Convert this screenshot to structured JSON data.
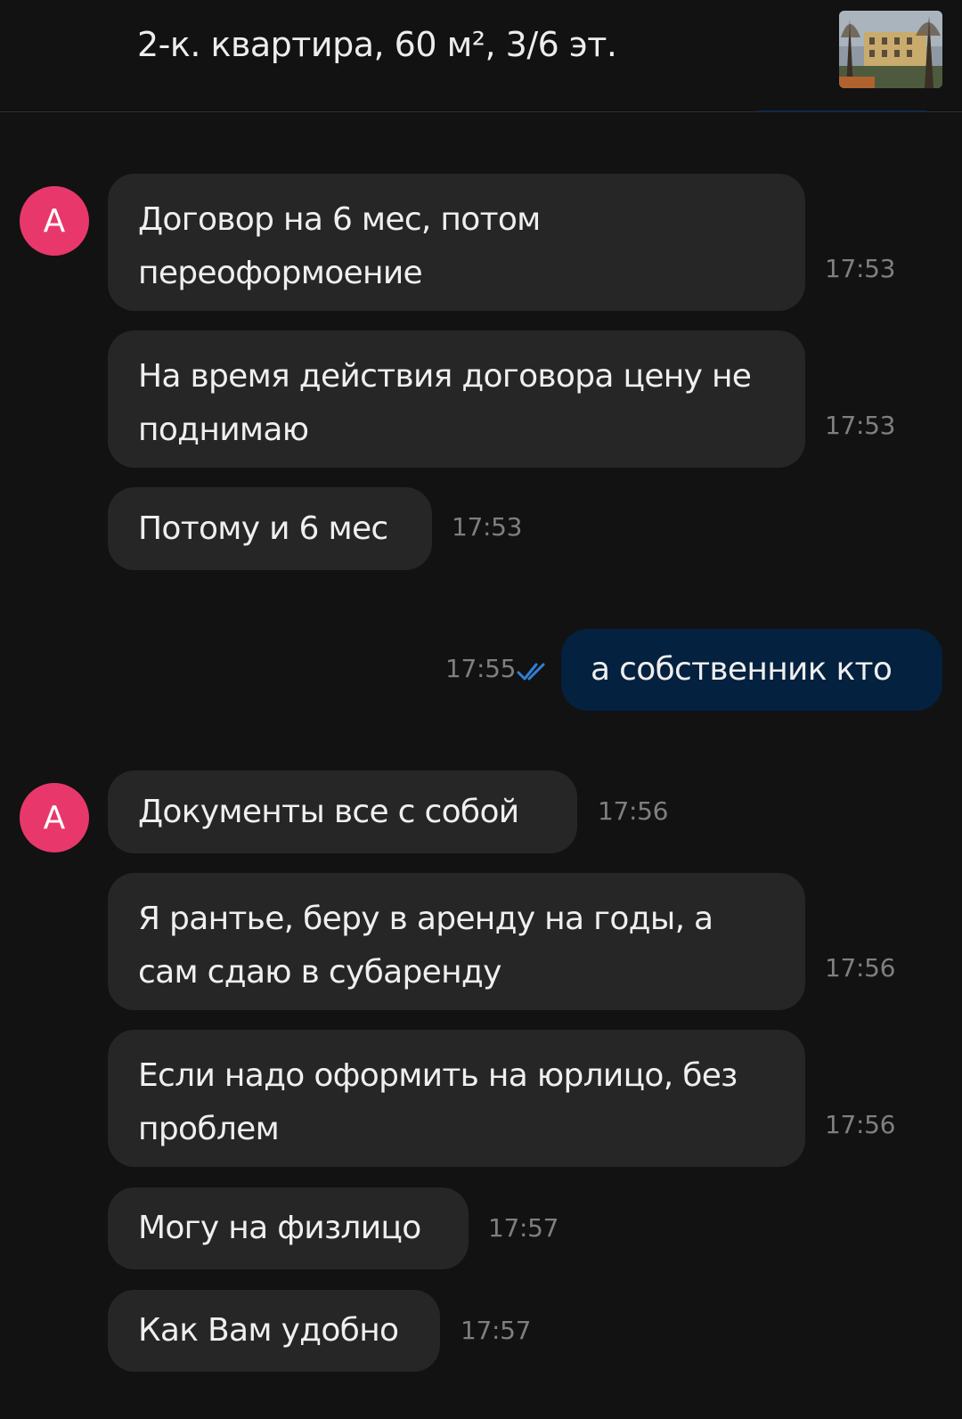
{
  "header": {
    "title": "2-к. квартира, 60 м², 3/6 эт."
  },
  "messages": [
    {
      "text": "Договор на 6 мес, потом переоформоение",
      "time": "17:53",
      "avatar": "А"
    },
    {
      "text": "На время действия договора цену не поднимаю",
      "time": "17:53"
    },
    {
      "text": "Потому и 6 мес",
      "time": "17:53"
    },
    {
      "text": "а собственник кто",
      "time": "17:55",
      "status_icon": "double-check-icon"
    },
    {
      "text": "Документы все с собой",
      "time": "17:56",
      "avatar": "А"
    },
    {
      "text": "Я рантье, беру в аренду на годы, а сам сдаю в субаренду",
      "time": "17:56"
    },
    {
      "text": "Если надо оформить на юрлицо, без проблем",
      "time": "17:56"
    },
    {
      "text": "Могу на физлицо",
      "time": "17:57"
    },
    {
      "text": "Как Вам удобно",
      "time": "17:57"
    }
  ],
  "colors": {
    "background": "#121212",
    "incoming_bubble": "#262626",
    "outgoing_bubble": "#04213f",
    "avatar": "#e8386b",
    "read_check": "#2f80d6"
  }
}
